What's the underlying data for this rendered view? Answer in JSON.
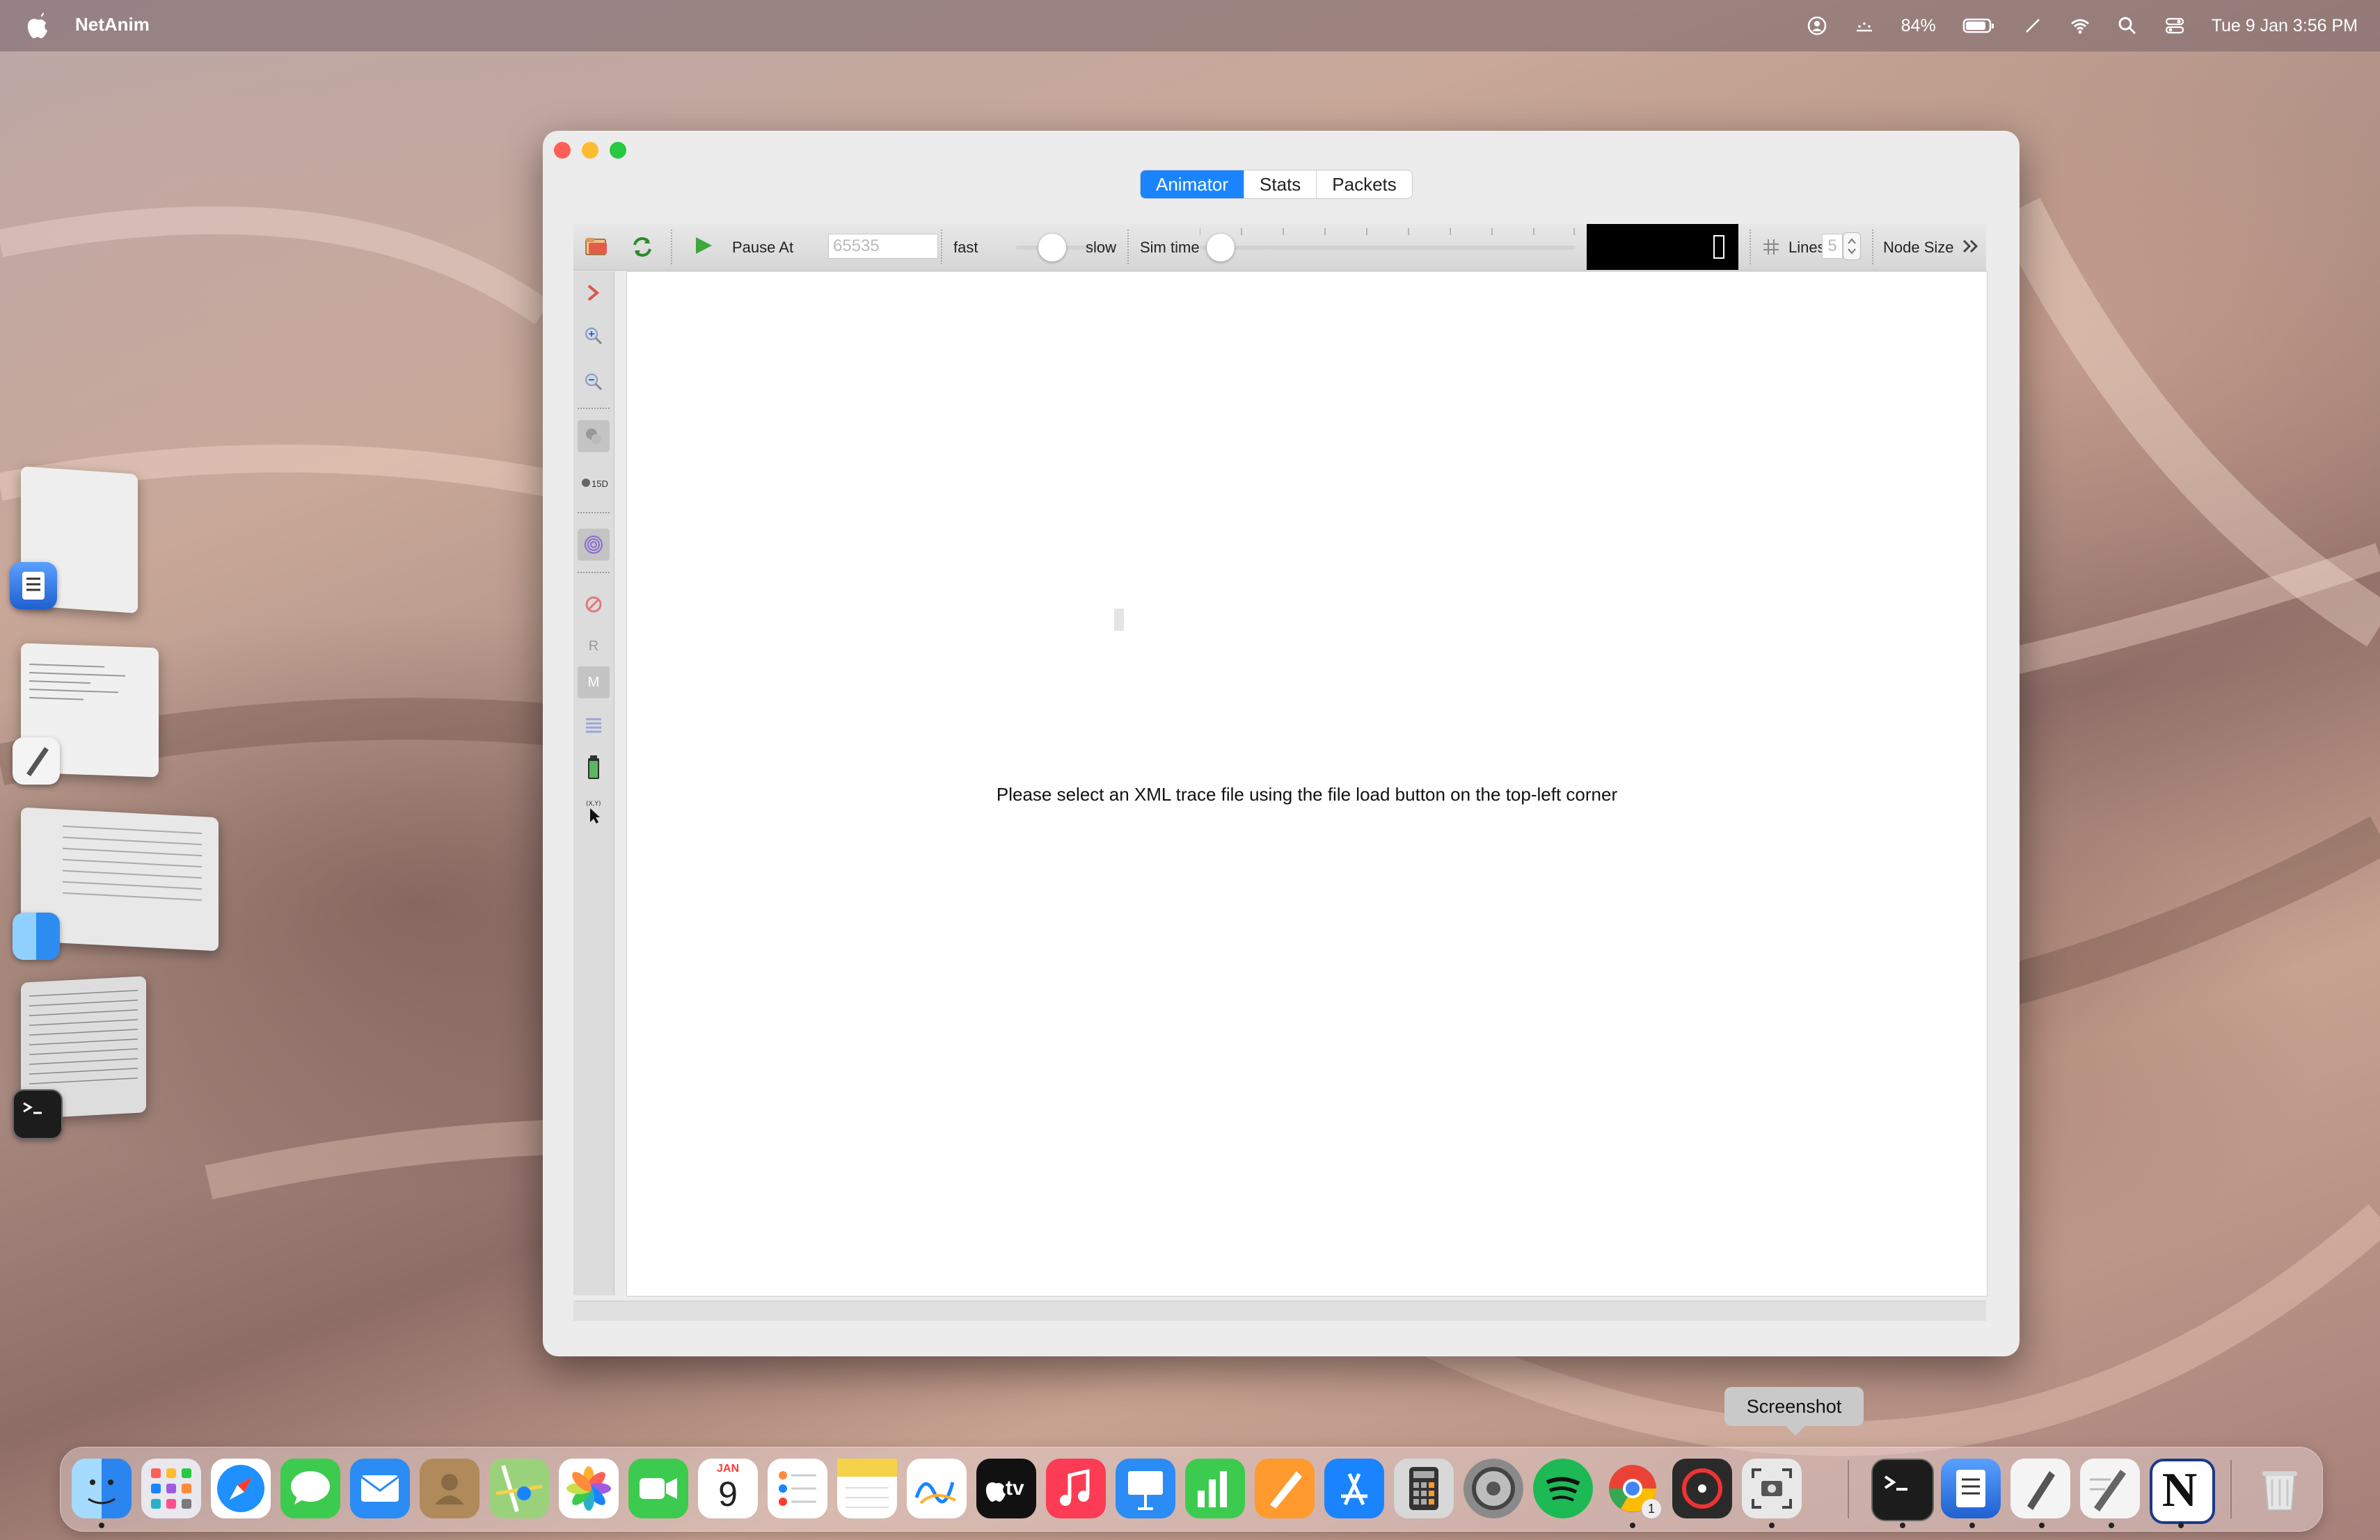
{
  "menubar": {
    "app_name": "NetAnim",
    "battery": "84%",
    "clock": "Tue 9 Jan  3:56 PM"
  },
  "window": {
    "tabs": [
      {
        "label": "Animator",
        "active": true
      },
      {
        "label": "Stats",
        "active": false
      },
      {
        "label": "Packets",
        "active": false
      }
    ],
    "toolbar": {
      "pause_at_label": "Pause At",
      "pause_at_value": "65535",
      "fast_label": "fast",
      "slow_label": "slow",
      "sim_time_label": "Sim time",
      "lines_label": "Lines",
      "lines_value": "5",
      "node_size_label": "Node Size"
    },
    "sidebar": {
      "resolution_label": "15D",
      "r_label": "R",
      "m_label": "M"
    },
    "canvas_message": "Please select an XML trace file using the file load button on the top-left corner"
  },
  "tooltip": "Screenshot",
  "dock": {
    "calendar_month": "JAN",
    "calendar_day": "9",
    "appletv_label": "tv",
    "chrome_badge": "1",
    "notion_letter": "N"
  },
  "colors": {
    "accent": "#1a84ff",
    "close": "#ff5f57",
    "minimize": "#febc2e",
    "maximize": "#28c840"
  }
}
